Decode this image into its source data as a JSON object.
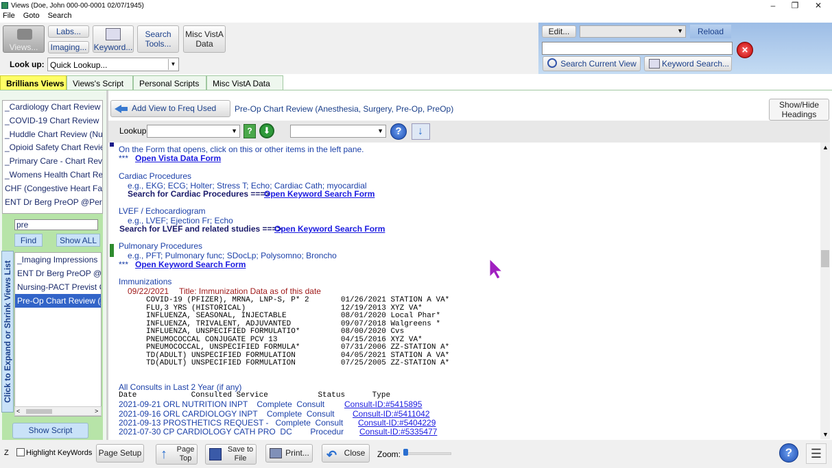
{
  "window": {
    "title": "Views (Doe, John  000-00-0001 02/07/1945)",
    "min": "–",
    "restore": "❐",
    "close": "✕"
  },
  "menu": [
    "File",
    "Goto",
    "Search"
  ],
  "toolbar": {
    "views": "Views...",
    "labs": "Labs...",
    "imaging": "Imaging...",
    "keyword": "Keyword...",
    "search_tools_1": "Search",
    "search_tools_2": "Tools...",
    "misc_1": "Misc VistA",
    "misc_2": "Data",
    "lookup_label": "Look up:",
    "lookup_value": "Quick Lookup..."
  },
  "right_panel": {
    "edit": "Edit...",
    "reload": "Reload",
    "search_current": "Search Current View",
    "keyword_search": "Keyword Search..."
  },
  "tabs": [
    "Brillians Views",
    "Views's Script",
    "Personal Scripts",
    "Misc VistA Data"
  ],
  "views_list": [
    "_Cardiology Chart Review",
    "_COVID-19 Chart Review",
    "_Huddle Chart Review (Nursi",
    "_Opioid Safety Chart Review",
    "_Primary Care - Chart Review",
    "_Womens Health Chart Revie",
    "CHF (Congestive Heart Fail C",
    "ENT Dr Berg PreOP @Person"
  ],
  "filter": {
    "value": "pre",
    "find": "Find",
    "show_all": "Show ALL"
  },
  "filtered_list": [
    "_Imaging Impressions",
    "ENT Dr Berg PreOP @Pe",
    "Nursing-PACT Previst Ch",
    "Pre-Op Chart Review (An"
  ],
  "vertical_label": "Click to Expand or Shrink Views List",
  "show_script": "Show Script",
  "view_header": {
    "add_freq": "Add View to Freq Used List",
    "view_title": "Pre-Op Chart Review (Anesthesia, Surgery, Pre-Op, PreOp)",
    "show_hide_1": "Show/Hide",
    "show_hide_2": "Headings",
    "lookup": "Lookup:"
  },
  "content": {
    "line0": "On the Form that opens, click on this or other items in the left pane.",
    "stars": "***",
    "open_vista": "Open Vista Data Form",
    "cardiac_head": "Cardiac Procedures",
    "cardiac_eg": "e.g., EKG; ECG; Holter; Stress T; Echo; Cardiac Cath; myocardial",
    "cardiac_search": "Search for Cardiac Procedures ===>",
    "open_keyword": "Open Keyword Search Form",
    "lvef_head": "LVEF / Echocardiogram",
    "lvef_eg": "e.g., LVEF; Ejection Fr; Echo",
    "lvef_search": "Search for LVEF and related studies ===>",
    "pulm_head": "Pulmonary Procedures",
    "pulm_eg": "e.g., PFT; Pulmonary func; SDocLp; Polysomno; Broncho",
    "imm_head": "Immunizations",
    "imm_date": "09/22/2021",
    "imm_title": "Title: Immunization Data as of this date",
    "imm_rows": [
      "COVID-19 (PFIZER), MRNA, LNP-S, P* 2       01/26/2021 STATION A VA*",
      "FLU,3 YRS (HISTORICAL)                     12/19/2013 XYZ VA*",
      "INFLUENZA, SEASONAL, INJECTABLE            08/01/2020 Local Phar*",
      "INFLUENZA, TRIVALENT, ADJUVANTED           09/07/2018 Walgreens *",
      "INFLUENZA, UNSPECIFIED FORMULATIO*         08/00/2020 Cvs",
      "PNEUMOCOCCAL CONJUGATE PCV 13              04/15/2016 XYZ VA*",
      "PNEUMOCOCCAL, UNSPECIFIED FORMULA*         07/31/2006 ZZ-STATION A*",
      "TD(ADULT) UNSPECIFIED FORMULATION          04/05/2021 STATION A VA*",
      "TD(ADULT) UNSPECIFIED FORMULATION          07/25/2005 ZZ-STATION A*"
    ],
    "consults_head": "All Consults in Last 2 Year (if any)",
    "consults_cols": "Date            Consulted Service           Status      Type",
    "consults": [
      {
        "text": "2021-09-21 ORL NUTRITION INPT    Complete  Consult",
        "id": "Consult-ID:#5415895"
      },
      {
        "text": "2021-09-16 ORL CARDIOLOGY INPT    Complete  Consult",
        "id": "Consult-ID:#5411042"
      },
      {
        "text": "2021-09-13 PROSTHETICS REQUEST -   Complete  Consult",
        "id": "Consult-ID:#5404229"
      },
      {
        "text": "2021-07-30 CP CARDIOLOGY CATH PRO  DC        Procedur",
        "id": "Consult-ID:#5335477"
      }
    ]
  },
  "bottom": {
    "z": "Z",
    "highlight": "Highlight KeyWords",
    "page_setup": "Page Setup",
    "page_top_1": "Page",
    "page_top_2": "Top",
    "save_1": "Save to",
    "save_2": "File",
    "print": "Print...",
    "close": "Close",
    "zoom": "Zoom:"
  }
}
